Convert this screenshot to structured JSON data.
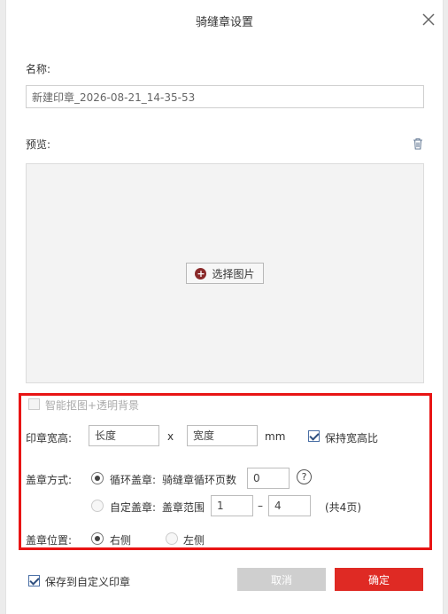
{
  "dialog": {
    "title": "骑缝章设置"
  },
  "name": {
    "label": "名称:",
    "value": "新建印章_2026-08-21_14-35-53"
  },
  "preview": {
    "label": "预览:",
    "choose_image_label": "选择图片"
  },
  "options": {
    "smart_cutout_label": "智能抠图+透明背景",
    "smart_cutout_checked": false,
    "size": {
      "label": "印章宽高:",
      "length_placeholder": "长度",
      "width_placeholder": "宽度",
      "times": "x",
      "unit": "mm",
      "keep_ratio_label": "保持宽高比",
      "keep_ratio_checked": true
    },
    "stamp_method": {
      "label": "盖章方式:",
      "cycle_label": "循环盖章:",
      "cycle_sub_label": "骑缝章循环页数",
      "cycle_value": "0",
      "help": "?",
      "custom_label": "自定盖章:",
      "custom_sub_label": "盖章范围",
      "range_from": "1",
      "range_dash": "–",
      "range_to": "4",
      "total_pages": "(共4页)",
      "selected": "cycle"
    },
    "position": {
      "label": "盖章位置:",
      "right_label": "右侧",
      "left_label": "左侧",
      "selected": "right"
    }
  },
  "footer": {
    "save_custom_label": "保存到自定义印章",
    "save_custom_checked": true,
    "cancel_label": "取消",
    "ok_label": "确定"
  },
  "colors": {
    "accent_red": "#df2a24",
    "highlight_red": "#e81414",
    "disabled_gray": "#cfcfcf"
  }
}
